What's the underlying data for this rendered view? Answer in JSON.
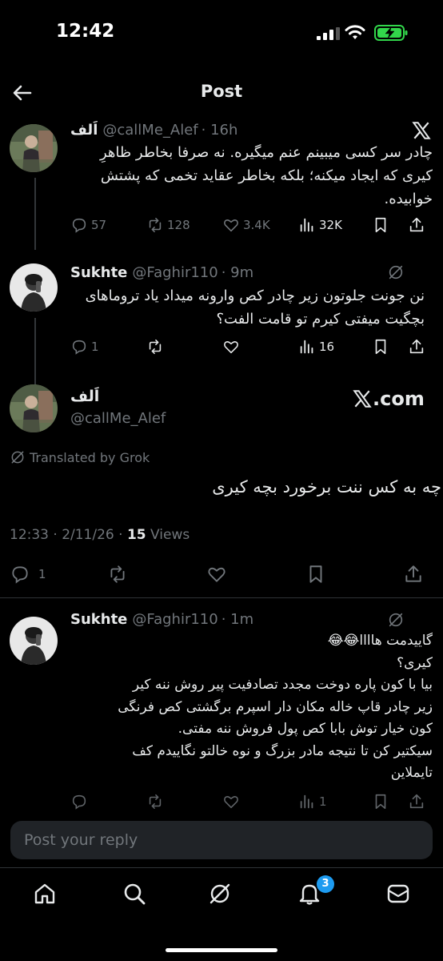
{
  "status": {
    "time": "12:42"
  },
  "header": {
    "title": "Post"
  },
  "tweets": [
    {
      "name": "اَلف",
      "handle": "@callMe_Alef",
      "time": "· 16h",
      "text": "چادر سر کسی میبینم عنم میگیره. نه صرفا بخاطر ظاهرِ کیری که ایجاد میکنه؛ بلکه بخاطر عقاید تخمی که پشتش خوابیده.",
      "replies": "57",
      "reposts": "128",
      "likes": "3.4K",
      "views": "32K"
    },
    {
      "name": "Sukhte",
      "handle": "@Faghir110",
      "time": "· 9m",
      "text": "نن جونت جلوتون زیر چادر کص وارونه میداد یاد تروماهای بچگیت میفتی کیرم تو قامت الفت؟",
      "replies": "1",
      "views": "16"
    }
  ],
  "main_tweet": {
    "name": "اَلف",
    "handle": "@callMe_Alef",
    "source": ".com",
    "translated": "Translated by Grok",
    "text": "چه به کس ننت برخورد بچه کیری",
    "timestamp": "12:33 · 2/11/26 · ",
    "views_count": "15",
    "views_label": "Views",
    "replies": "1"
  },
  "last_reply": {
    "name": "Sukhte",
    "handle": "@Faghir110",
    "time": "· 1m",
    "lines": [
      "گاییدمت هاااا😂😂",
      "کیری؟",
      "بیا با کون پاره دوخت مجدد تصادفیت پیر روش ننه کیر",
      "زیر چادر قاپ خاله مکان دار اسپرم برگشتی کص فرنگی",
      "کون خیار توش بابا کص پول فروش ننه مفتی.",
      "سیکتیر کن تا نتیجه مادر بزرگ و نوه خالتو نگاییدم کف",
      "تایملاین"
    ],
    "views": "1"
  },
  "reply_bar": {
    "placeholder": "Post your reply"
  },
  "tabbar": {
    "notifications_badge": "3"
  },
  "icons": [
    "back-arrow-icon",
    "x-logo-icon",
    "reply-icon",
    "repost-icon",
    "like-icon",
    "views-icon",
    "bookmark-icon",
    "share-icon",
    "grok-icon",
    "home-icon",
    "search-icon",
    "notifications-icon",
    "messages-icon"
  ],
  "colors": {
    "background": "#000000",
    "text": "#e7e9ea",
    "muted": "#71767b",
    "accent": "#1d9bf0",
    "battery": "#32d74b"
  }
}
